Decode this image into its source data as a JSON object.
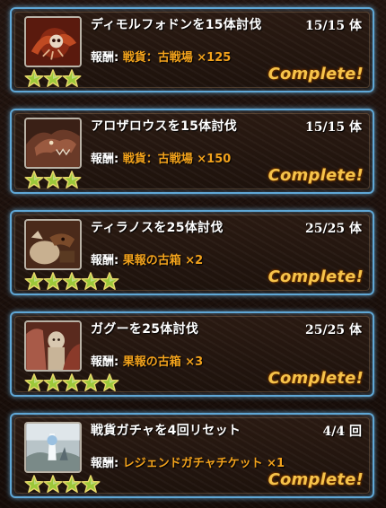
{
  "missions": [
    {
      "title": "ディモルフォドンを15体討伐",
      "count": "15/15 体",
      "reward_label": "報酬:",
      "reward_value": "戦貨：古戦場 ×125",
      "stars": 3,
      "status": "Complete!",
      "thumb_icon": "dimorphodon-icon"
    },
    {
      "title": "アロザロウスを15体討伐",
      "count": "15/15 体",
      "reward_label": "報酬:",
      "reward_value": "戦貨：古戦場 ×150",
      "stars": 3,
      "status": "Complete!",
      "thumb_icon": "allosaurus-icon"
    },
    {
      "title": "ティラノスを25体討伐",
      "count": "25/25 体",
      "reward_label": "報酬:",
      "reward_value": "果報の古箱 ×2",
      "stars": 5,
      "status": "Complete!",
      "thumb_icon": "tyranos-icon"
    },
    {
      "title": "ガグーを25体討伐",
      "count": "25/25 体",
      "reward_label": "報酬:",
      "reward_value": "果報の古箱 ×3",
      "stars": 5,
      "status": "Complete!",
      "thumb_icon": "gagoo-icon"
    },
    {
      "title": "戦貨ガチャを4回リセット",
      "count": "4/4 回",
      "reward_label": "報酬:",
      "reward_value": "レジェンドガチャチケット ×1",
      "stars": 4,
      "status": "Complete!",
      "thumb_icon": "gacha-ticket-icon"
    }
  ],
  "colors": {
    "card_border": "#5fa7d6",
    "reward_value": "#f2a21c",
    "complete": "#f6c34a",
    "star": "#9cc83a"
  }
}
